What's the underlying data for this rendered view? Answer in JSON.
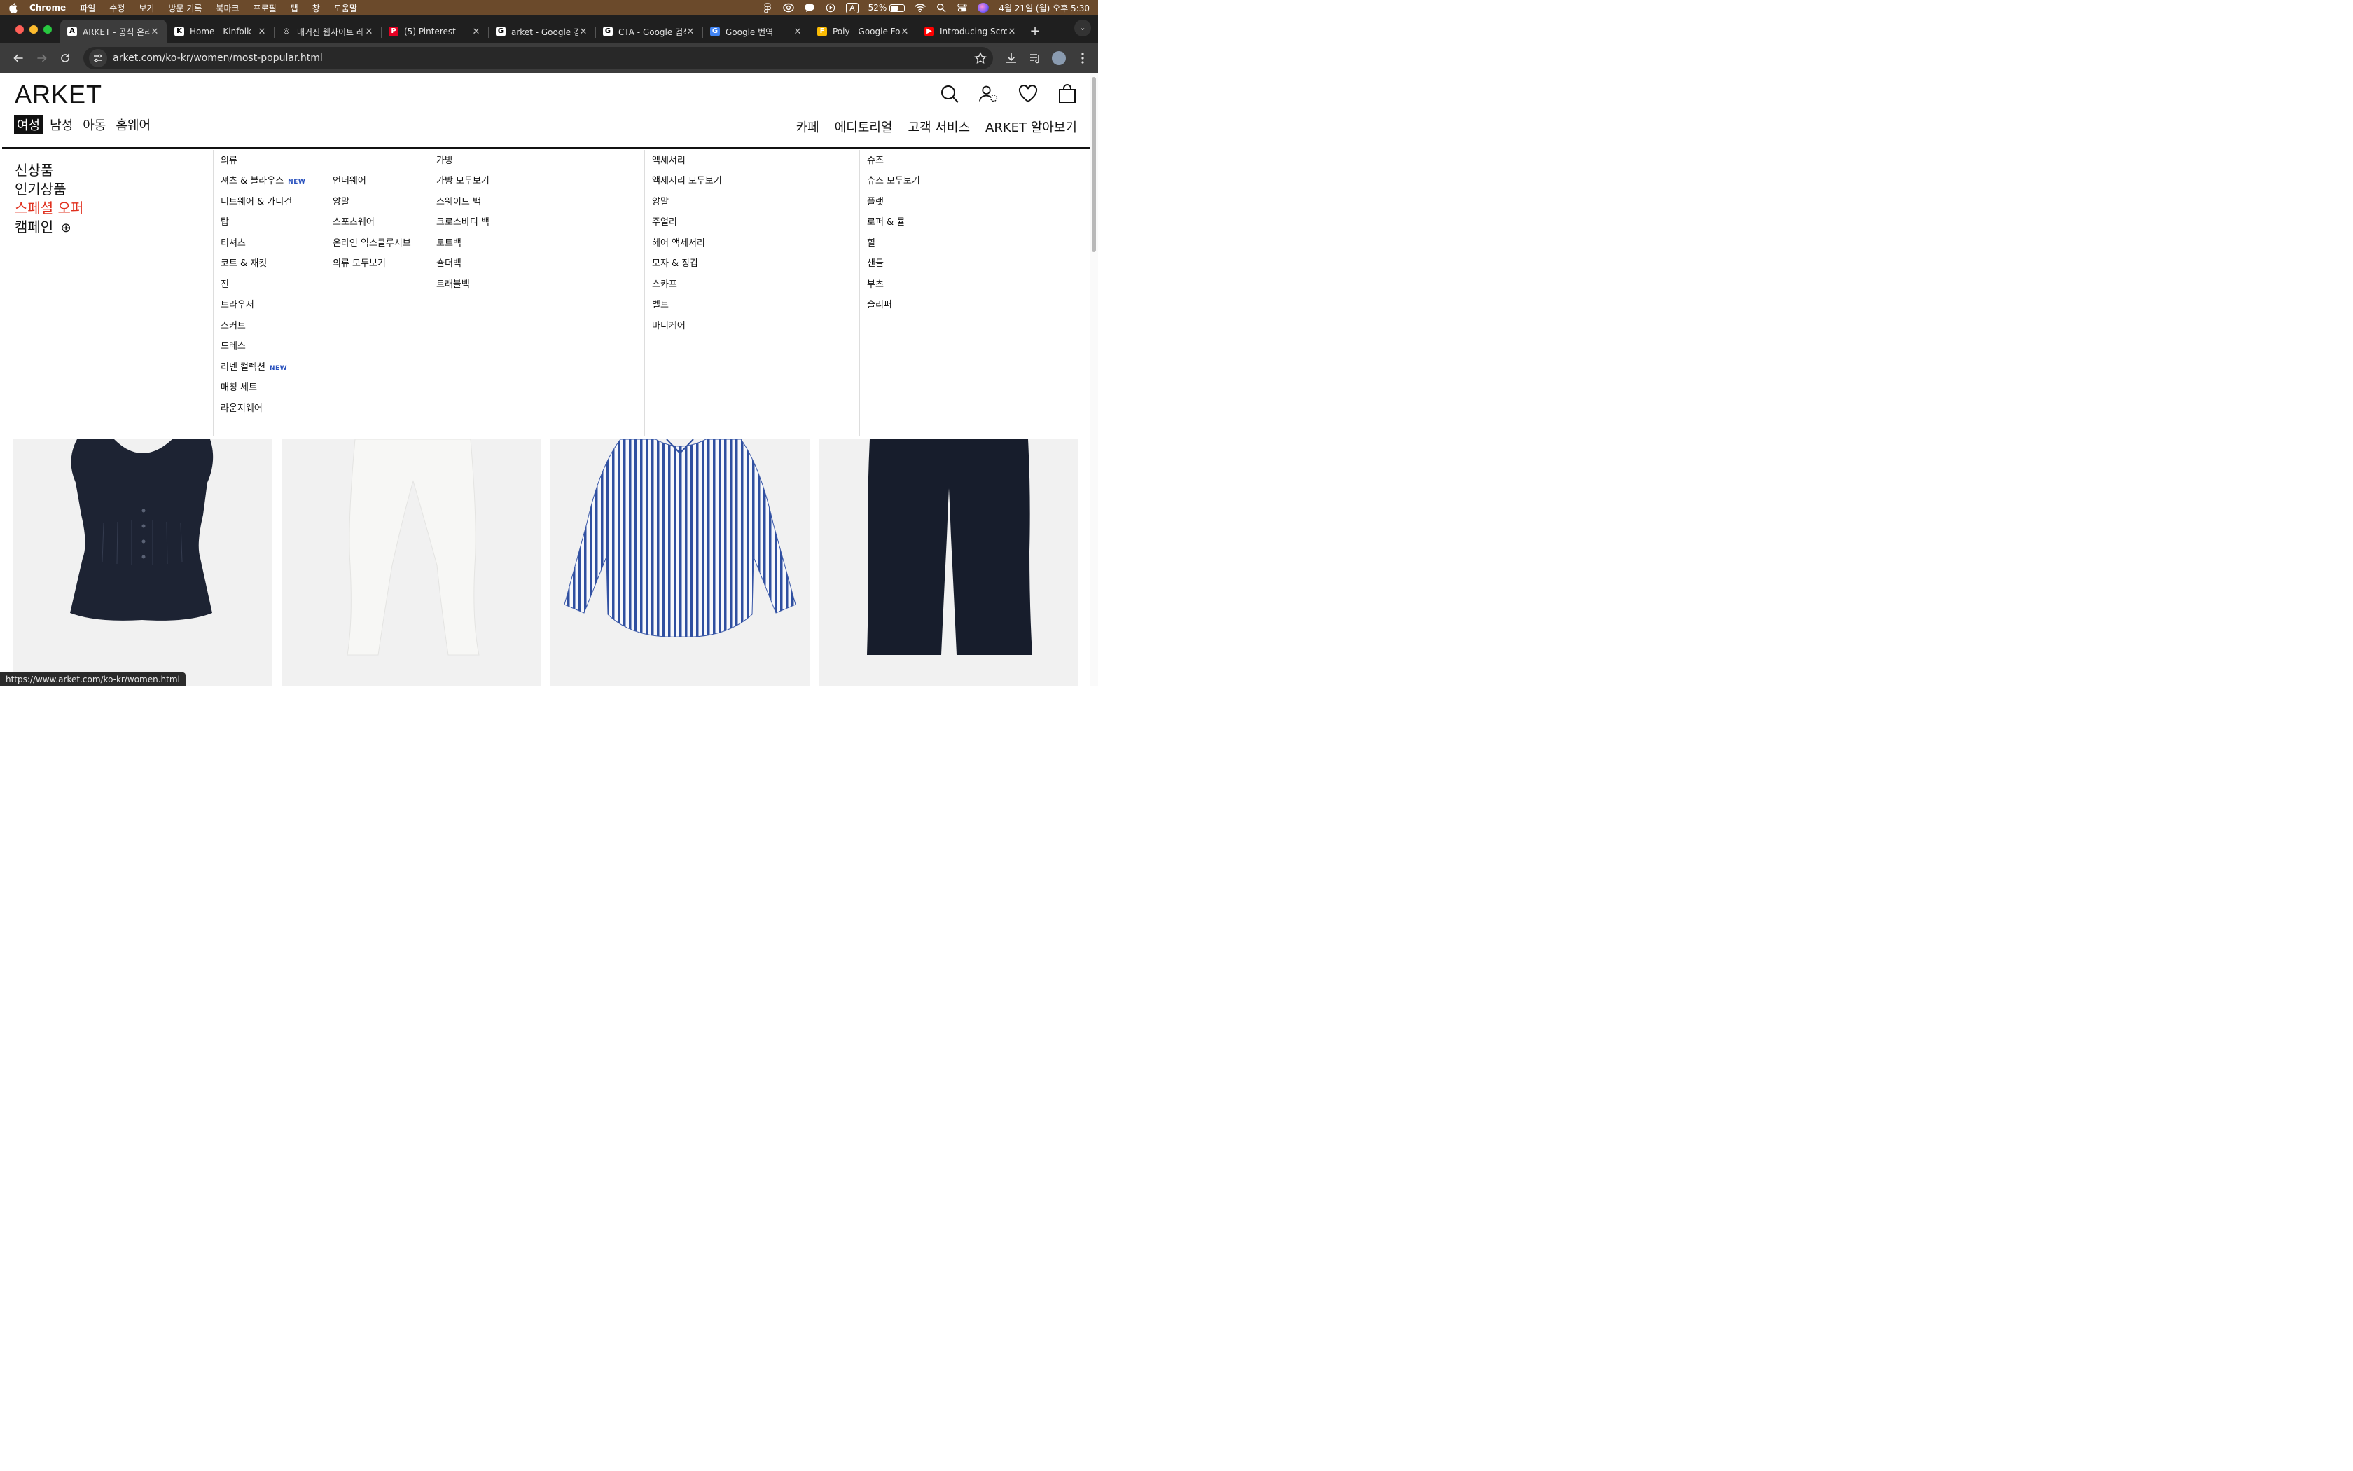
{
  "os_menubar": {
    "app": "Chrome",
    "items": [
      "파일",
      "수정",
      "보기",
      "방문 기록",
      "북마크",
      "프로필",
      "탭",
      "창",
      "도움말"
    ],
    "input_indicator": "A",
    "battery_percent": "52%",
    "battery_level": 0.52,
    "datetime": "4월 21일 (월) 오후 5:30"
  },
  "browser": {
    "tabs": [
      {
        "label": "ARKET - 공식 온라인",
        "icon": "arket-favicon",
        "fav_text": "A",
        "fav_color": "#ffffff",
        "active": true
      },
      {
        "label": "Home - Kinfolk",
        "icon": "kinfolk-favicon",
        "fav_text": "K",
        "fav_color": "#ffffff"
      },
      {
        "label": "매거진 웹사이트 레퍼런스",
        "icon": "chatgpt-favicon",
        "fav_text": "◎",
        "fav_color": "#1f1f1f"
      },
      {
        "label": "(5) Pinterest",
        "icon": "pinterest-favicon",
        "fav_text": "P",
        "fav_color": "#e60023"
      },
      {
        "label": "arket - Google 검색",
        "icon": "google-favicon",
        "fav_text": "G",
        "fav_color": "#ffffff"
      },
      {
        "label": "CTA - Google 검색",
        "icon": "google-favicon",
        "fav_text": "G",
        "fav_color": "#ffffff"
      },
      {
        "label": "Google 번역",
        "icon": "google-translate-favicon",
        "fav_text": "G",
        "fav_color": "#4285f4"
      },
      {
        "label": "Poly - Google Fonts",
        "icon": "google-fonts-favicon",
        "fav_text": "F",
        "fav_color": "#fbbc04"
      },
      {
        "label": "Introducing Scroll",
        "icon": "youtube-favicon",
        "fav_text": "▶",
        "fav_color": "#ff0000"
      }
    ],
    "url": "arket.com/ko-kr/women/most-popular.html",
    "status_url": "https://www.arket.com/ko-kr/women.html"
  },
  "site": {
    "logo": "ARKET",
    "categories": [
      {
        "label": "여성",
        "active": true
      },
      {
        "label": "남성"
      },
      {
        "label": "아동"
      },
      {
        "label": "홈웨어"
      }
    ],
    "header_links": [
      "카페",
      "에디토리얼",
      "고객 서비스",
      "ARKET 알아보기"
    ],
    "mega": {
      "left": {
        "new": "신상품",
        "popular": "인기상품",
        "sale": "스페셜 오퍼",
        "campaign": "캠페인",
        "campaign_plus": "⊕"
      },
      "clothing": {
        "heading": "의류",
        "new_badge": "NEW",
        "col1": [
          "셔츠 & 블라우스",
          "니트웨어 & 가디건",
          "탑",
          "티셔츠",
          "코트 & 재킷",
          "진",
          "트라우저",
          "스커트",
          "드레스",
          "리넨 컬렉션",
          "매칭 세트",
          "라운지웨어"
        ],
        "col2": [
          "언더웨어",
          "양말",
          "스포츠웨어",
          "온라인 익스클루시브",
          "의류 모두보기"
        ]
      },
      "bags": {
        "heading": "가방",
        "items": [
          "가방 모두보기",
          "스웨이드 백",
          "크로스바디 백",
          "토트백",
          "숄더백",
          "트래블백"
        ]
      },
      "accessories": {
        "heading": "액세서리",
        "items": [
          "액세서리 모두보기",
          "양말",
          "주얼리",
          "헤어 액세서리",
          "모자 & 장갑",
          "스카프",
          "벨트",
          "바디케어"
        ]
      },
      "shoes": {
        "heading": "슈즈",
        "items": [
          "슈즈 모두보기",
          "플랫",
          "로퍼 & 뮬",
          "힐",
          "샌들",
          "부츠",
          "슬리퍼"
        ]
      }
    },
    "products": [
      {
        "type": "sleeveless-pintuck-top",
        "color": "#1d2333"
      },
      {
        "type": "white-barrel-trousers",
        "color": "#f7f7f5"
      },
      {
        "type": "striped-shirt",
        "color": "#2f4fa0"
      },
      {
        "type": "navy-wide-trousers",
        "color": "#171d2c"
      }
    ]
  }
}
